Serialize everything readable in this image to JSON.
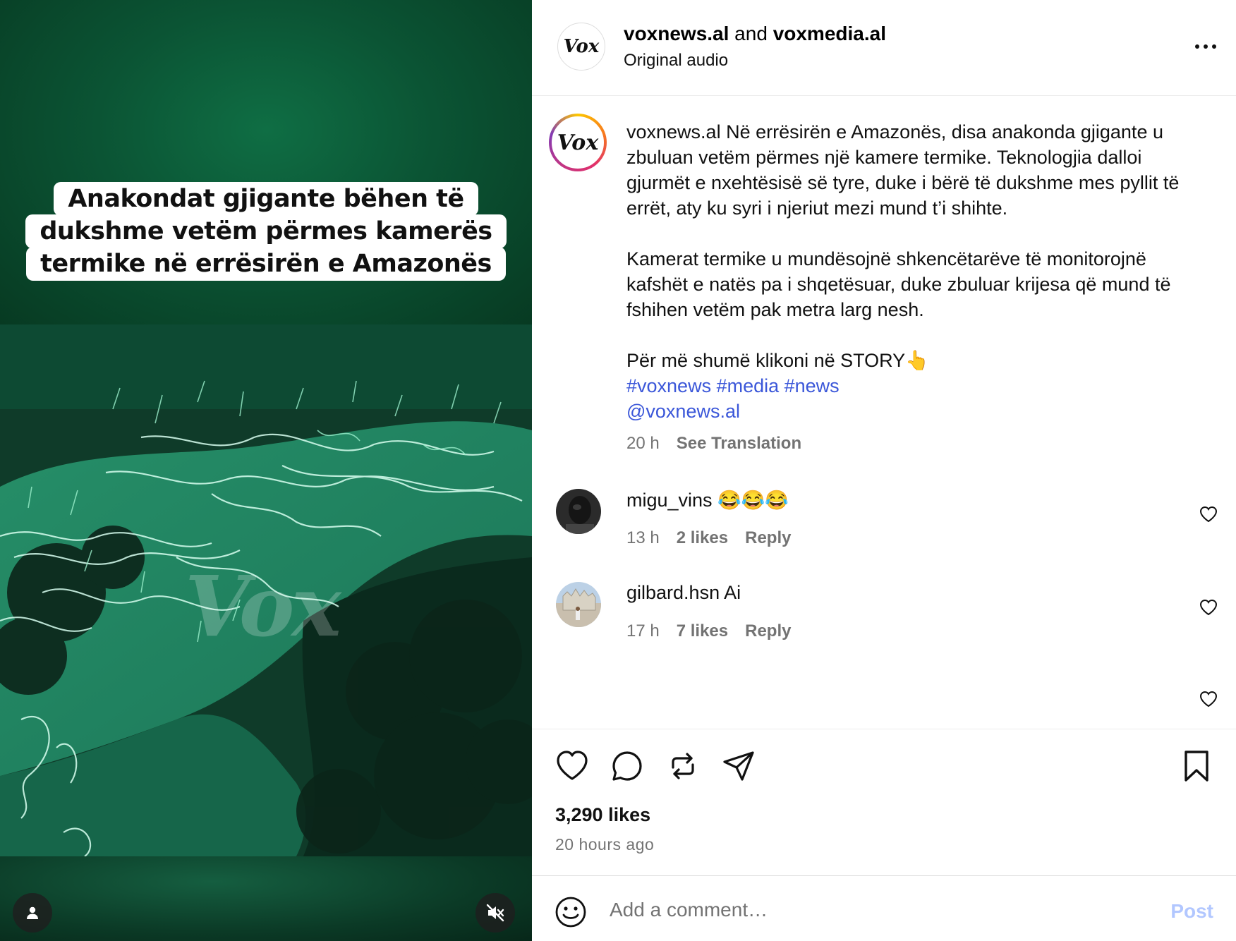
{
  "media": {
    "overlay_lines": [
      "Anakondat gjigante bëhen të",
      "dukshme vetëm përmes kamerës",
      "termike në errësirën e Amazonës"
    ],
    "watermark": "Vox",
    "icons": {
      "profile": "person-icon",
      "mute": "mute-icon"
    }
  },
  "header": {
    "avatar_text": "Vox",
    "author": "voxnews.al",
    "joiner": " and ",
    "coauthor": "voxmedia.al",
    "subtitle": "Original audio"
  },
  "caption": {
    "avatar_text": "Vox",
    "username": "voxnews.al",
    "paragraph1": " Në errësirën e Amazonës, disa anakonda gjigante u zbuluan vetëm përmes një kamere termike. Teknologjia dalloi gjurmët e nxehtësisë së tyre, duke i bërë të dukshme mes pyllit të errët, aty ku syri i njeriut mezi mund t’i shihte.",
    "paragraph2": "Kamerat termike u mundësojnë shkencëtarëve të monitorojnë kafshët e natës pa i shqetësuar, duke zbuluar krijesa që mund të fshihen vetëm pak metra larg nesh.",
    "cta": "Për më shumë klikoni në STORY👆",
    "hashtags": "#voxnews #media #news",
    "mention": "@voxnews.al",
    "time": "20 h",
    "see_translation": "See Translation"
  },
  "comments": [
    {
      "username": "migu_vins",
      "text": " 😂😂😂",
      "time": "13 h",
      "likes": "2 likes",
      "reply": "Reply"
    },
    {
      "username": "gilbard.hsn",
      "text": " Ai",
      "time": "17 h",
      "likes": "7 likes",
      "reply": "Reply"
    }
  ],
  "actions": {
    "likes": "3,290 likes",
    "time_ago": "20 hours ago",
    "icons": [
      "heart-icon",
      "comment-icon",
      "repost-icon",
      "share-icon",
      "bookmark-icon"
    ]
  },
  "add_comment": {
    "placeholder": "Add a comment…",
    "post_label": "Post",
    "post_color": "#b2c7ff"
  },
  "colors": {
    "link": "#3b57d9",
    "muted": "#737373"
  }
}
